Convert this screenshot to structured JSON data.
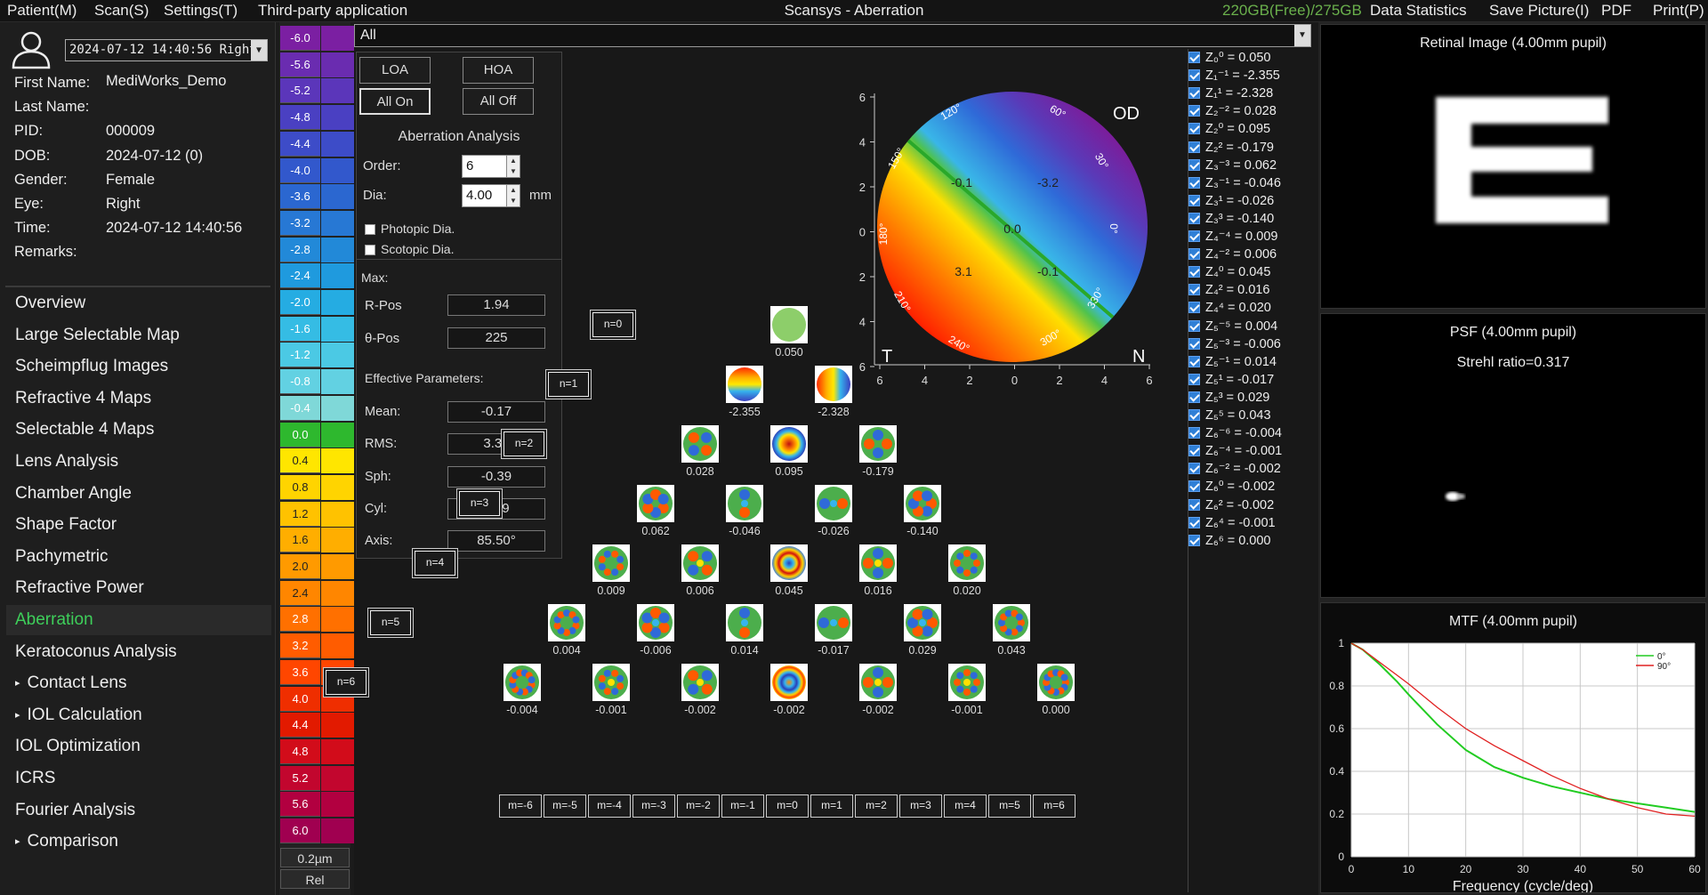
{
  "menu": {
    "patient": "Patient(M)",
    "scan": "Scan(S)",
    "settings": "Settings(T)",
    "third_party": "Third-party application",
    "title": "Scansys - Aberration",
    "storage": "220GB(Free)/275GB",
    "data_statistics": "Data Statistics",
    "save_picture": "Save Picture(I)",
    "pdf": "PDF",
    "print": "Print(P)"
  },
  "patient": {
    "exam_select": "2024-07-12 14:40:56 Right",
    "first_name_label": "First Name:",
    "first_name": "MediWorks_Demo",
    "last_name_label": "Last Name:",
    "last_name": "",
    "pid_label": "PID:",
    "pid": "000009",
    "dob_label": "DOB:",
    "dob": "2024-07-12  (0)",
    "gender_label": "Gender:",
    "gender": "Female",
    "eye_label": "Eye:",
    "eye": "Right",
    "time_label": "Time:",
    "time": "2024-07-12 14:40:56",
    "remarks_label": "Remarks:",
    "remarks": ""
  },
  "nav": [
    {
      "label": "Overview",
      "active": false,
      "bullet": false
    },
    {
      "label": "Large Selectable Map",
      "active": false,
      "bullet": false
    },
    {
      "label": "Scheimpflug Images",
      "active": false,
      "bullet": false
    },
    {
      "label": "Refractive 4 Maps",
      "active": false,
      "bullet": false
    },
    {
      "label": "Selectable 4 Maps",
      "active": false,
      "bullet": false
    },
    {
      "label": "Lens Analysis",
      "active": false,
      "bullet": false
    },
    {
      "label": "Chamber Angle",
      "active": false,
      "bullet": false
    },
    {
      "label": "Shape Factor",
      "active": false,
      "bullet": false
    },
    {
      "label": "Pachymetric",
      "active": false,
      "bullet": false
    },
    {
      "label": "Refractive Power",
      "active": false,
      "bullet": false
    },
    {
      "label": "Aberration",
      "active": true,
      "bullet": false
    },
    {
      "label": "Keratoconus Analysis",
      "active": false,
      "bullet": false
    },
    {
      "label": "Contact Lens",
      "active": false,
      "bullet": true
    },
    {
      "label": "IOL Calculation",
      "active": false,
      "bullet": true
    },
    {
      "label": "IOL Optimization",
      "active": false,
      "bullet": false
    },
    {
      "label": "ICRS",
      "active": false,
      "bullet": false
    },
    {
      "label": "Fourier Analysis",
      "active": false,
      "bullet": false
    },
    {
      "label": "Comparison",
      "active": false,
      "bullet": true
    }
  ],
  "scale": {
    "values": [
      "-6.0",
      "-5.6",
      "-5.2",
      "-4.8",
      "-4.4",
      "-4.0",
      "-3.6",
      "-3.2",
      "-2.8",
      "-2.4",
      "-2.0",
      "-1.6",
      "-1.2",
      "-0.8",
      "-0.4",
      "0.0",
      "0.4",
      "0.8",
      "1.2",
      "1.6",
      "2.0",
      "2.4",
      "2.8",
      "3.2",
      "3.6",
      "4.0",
      "4.4",
      "4.8",
      "5.2",
      "5.6",
      "6.0"
    ],
    "colors": [
      "#7b1fa2",
      "#6a2cb0",
      "#5b36ba",
      "#4a40c2",
      "#3d4cc8",
      "#3258cc",
      "#2b67d0",
      "#2778d4",
      "#2289d8",
      "#1f9ade",
      "#25ace2",
      "#35bce4",
      "#4bc9e4",
      "#62d1e2",
      "#7fd8d8",
      "#2eb82e",
      "#ffe600",
      "#ffd400",
      "#ffc200",
      "#ffae00",
      "#ff9a00",
      "#ff8600",
      "#ff7000",
      "#ff5c00",
      "#ff4600",
      "#ef2e00",
      "#e21a00",
      "#d20c1a",
      "#c2062e",
      "#b20040",
      "#a00050"
    ],
    "step": "0.2µm",
    "mode": "Rel"
  },
  "top_select": "All",
  "controls": {
    "loa": "LOA",
    "hoa": "HOA",
    "all_on": "All On",
    "all_off": "All Off",
    "title": "Aberration Analysis",
    "order_label": "Order:",
    "order": "6",
    "dia_label": "Dia:",
    "dia": "4.00",
    "dia_unit": "mm",
    "photopic": "Photopic Dia.",
    "scotopic": "Scotopic Dia.",
    "max_label": "Max:",
    "rpos_label": "R-Pos",
    "rpos": "1.94",
    "thpos_label": "θ-Pos",
    "thpos": "225",
    "eff_label": "Effective Parameters:",
    "mean_label": "Mean:",
    "mean": "-0.17",
    "rms_label": "RMS:",
    "rms": "3.32",
    "sph_label": "Sph:",
    "sph": "-0.39",
    "cyl_label": "Cyl:",
    "cyl": "0.59",
    "axis_label": "Axis:",
    "axis": "85.50°"
  },
  "polar_map": {
    "eye": "OD",
    "temporal": "T",
    "nasal": "N",
    "x_ticks": [
      "6",
      "4",
      "2",
      "0",
      "2",
      "4",
      "6"
    ],
    "y_ticks": [
      "6",
      "4",
      "2",
      "0",
      "2",
      "4",
      "6"
    ],
    "angles": [
      "120°",
      "60°",
      "30°",
      "0°",
      "330°",
      "300°",
      "240°",
      "210°",
      "180°",
      "150°"
    ],
    "values": [
      "-0.1",
      "-3.2",
      "0.0",
      "3.1",
      "-0.1"
    ]
  },
  "pyramid": {
    "rows": [
      {
        "label": "n=0",
        "values": [
          "0.050"
        ]
      },
      {
        "label": "n=1",
        "values": [
          "-2.355",
          "-2.328"
        ]
      },
      {
        "label": "n=2",
        "values": [
          "0.028",
          "0.095",
          "-0.179"
        ]
      },
      {
        "label": "n=3",
        "values": [
          "0.062",
          "-0.046",
          "-0.026",
          "-0.140"
        ]
      },
      {
        "label": "n=4",
        "values": [
          "0.009",
          "0.006",
          "0.045",
          "0.016",
          "0.020"
        ]
      },
      {
        "label": "n=5",
        "values": [
          "0.004",
          "-0.006",
          "0.014",
          "-0.017",
          "0.029",
          "0.043"
        ]
      },
      {
        "label": "n=6",
        "values": [
          "-0.004",
          "-0.001",
          "-0.002",
          "-0.002",
          "-0.002",
          "-0.001",
          "0.000"
        ]
      }
    ],
    "m_labels": [
      "m=-6",
      "m=-5",
      "m=-4",
      "m=-3",
      "m=-2",
      "m=-1",
      "m=0",
      "m=1",
      "m=2",
      "m=3",
      "m=4",
      "m=5",
      "m=6"
    ]
  },
  "zernike": [
    "Z₀⁰ = 0.050",
    "Z₁⁻¹ = -2.355",
    "Z₁¹ = -2.328",
    "Z₂⁻² = 0.028",
    "Z₂⁰ = 0.095",
    "Z₂² = -0.179",
    "Z₃⁻³ = 0.062",
    "Z₃⁻¹ = -0.046",
    "Z₃¹ = -0.026",
    "Z₃³ = -0.140",
    "Z₄⁻⁴ = 0.009",
    "Z₄⁻² = 0.006",
    "Z₄⁰ = 0.045",
    "Z₄² = 0.016",
    "Z₄⁴ = 0.020",
    "Z₅⁻⁵ = 0.004",
    "Z₅⁻³ = -0.006",
    "Z₅⁻¹ = 0.014",
    "Z₅¹ = -0.017",
    "Z₅³ = 0.029",
    "Z₅⁵ = 0.043",
    "Z₆⁻⁶ = -0.004",
    "Z₆⁻⁴ = -0.001",
    "Z₆⁻² = -0.002",
    "Z₆⁰ = -0.002",
    "Z₆² = -0.002",
    "Z₆⁴ = -0.001",
    "Z₆⁶ = 0.000"
  ],
  "retinal": {
    "title": "Retinal Image (4.00mm pupil)"
  },
  "psf": {
    "title": "PSF (4.00mm pupil)",
    "strehl": "Strehl ratio=0.317"
  },
  "mtf": {
    "title": "MTF (4.00mm pupil)",
    "xlabel": "Frequency (cycle/deg)",
    "x_ticks": [
      "0",
      "10",
      "20",
      "30",
      "40",
      "50",
      "60"
    ],
    "y_ticks": [
      "0",
      "0.2",
      "0.4",
      "0.6",
      "0.8",
      "1"
    ],
    "colors": {
      "0deg": "#22cc22",
      "90deg": "#e02020"
    }
  },
  "chart_data": {
    "type": "line",
    "title": "MTF (4.00mm pupil)",
    "xlabel": "Frequency (cycle/deg)",
    "ylabel": "",
    "xlim": [
      0,
      60
    ],
    "ylim": [
      0,
      1
    ],
    "grid": true,
    "legend": "top-right",
    "series": [
      {
        "name": "0°",
        "x": [
          0,
          2,
          5,
          8,
          10,
          15,
          20,
          25,
          30,
          35,
          40,
          45,
          50,
          55,
          60
        ],
        "values": [
          1.0,
          0.97,
          0.9,
          0.82,
          0.76,
          0.62,
          0.5,
          0.42,
          0.37,
          0.33,
          0.3,
          0.27,
          0.25,
          0.23,
          0.21
        ]
      },
      {
        "name": "90°",
        "x": [
          0,
          2,
          5,
          8,
          10,
          15,
          20,
          25,
          30,
          35,
          40,
          45,
          50,
          55,
          60
        ],
        "values": [
          1.0,
          0.97,
          0.91,
          0.85,
          0.81,
          0.7,
          0.6,
          0.52,
          0.45,
          0.38,
          0.32,
          0.27,
          0.23,
          0.2,
          0.19
        ]
      }
    ]
  }
}
